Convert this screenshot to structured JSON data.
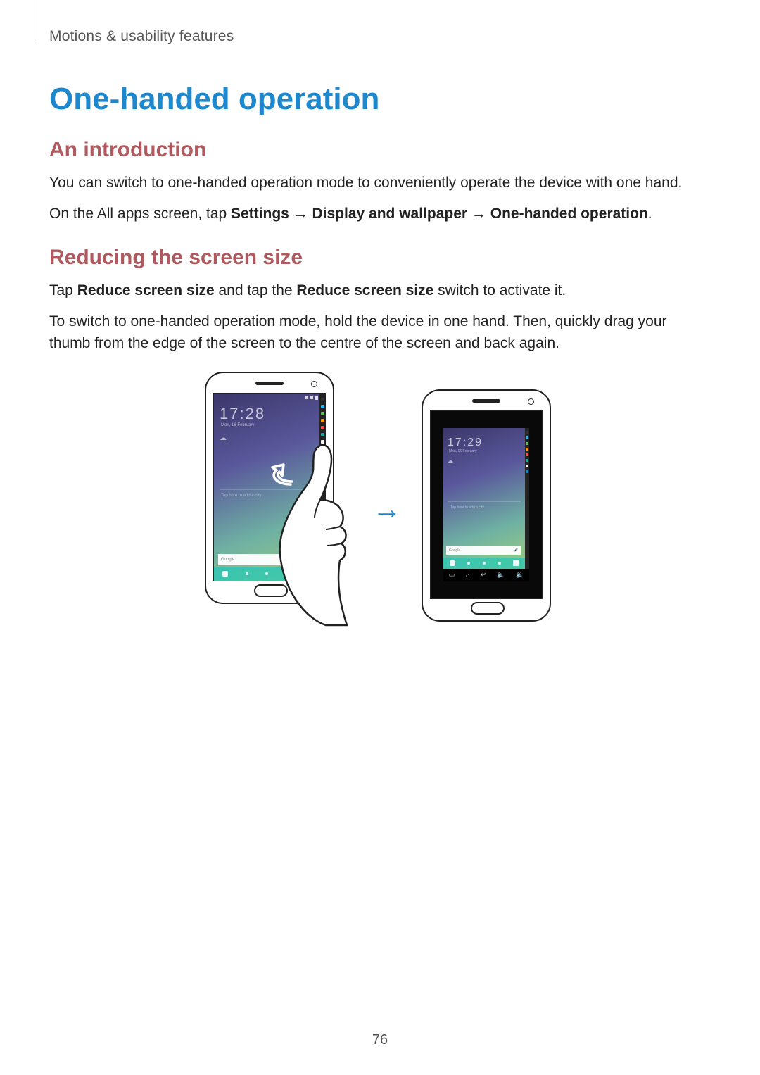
{
  "breadcrumb": "Motions & usability features",
  "title": "One-handed operation",
  "sections": {
    "intro": {
      "heading": "An introduction",
      "p1": "You can switch to one-handed operation mode to conveniently operate the device with one hand.",
      "p2_prefix": "On the All apps screen, tap ",
      "p2_b1": "Settings",
      "p2_arrow": " → ",
      "p2_b2": "Display and wallpaper",
      "p2_b3": "One-handed operation",
      "p2_suffix": "."
    },
    "reduce": {
      "heading": "Reducing the screen size",
      "p1_prefix": "Tap ",
      "p1_b1": "Reduce screen size",
      "p1_mid": " and tap the ",
      "p1_b2": "Reduce screen size",
      "p1_suffix": " switch to activate it.",
      "p2": "To switch to one-handed operation mode, hold the device in one hand. Then, quickly drag your thumb from the edge of the screen to the centre of the screen and back again."
    }
  },
  "figure": {
    "left_clock": "17:28",
    "left_date": "Mon, 16 February",
    "right_clock": "17:29",
    "right_date": "Mon, 16 February",
    "tap_hint": "Tap here to add a city",
    "search": "Google",
    "mic_glyph": "🎤",
    "weather_glyph": "☁",
    "close_glyph": "⤢",
    "nav": {
      "recents": "▭",
      "home": "⌂",
      "back": "↩",
      "vol_down": "🔈",
      "vol_up": "🔉"
    },
    "transition_arrow": "→"
  },
  "page_number": "76"
}
